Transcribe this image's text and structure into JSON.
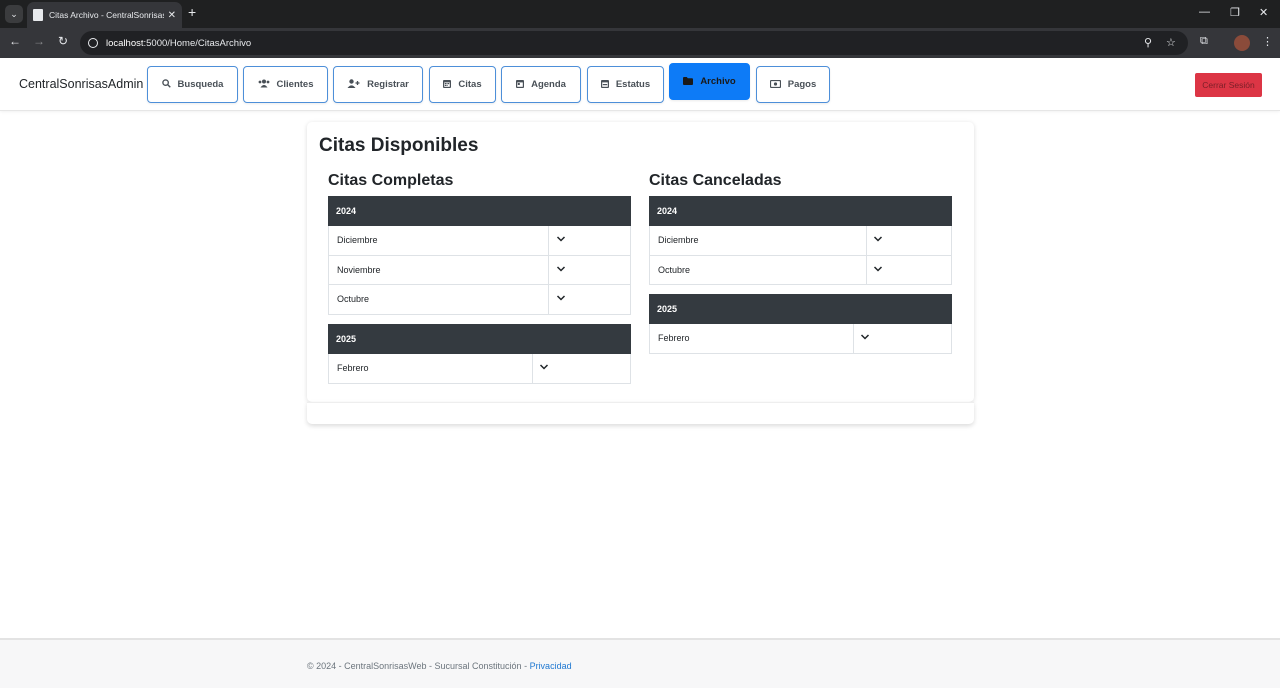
{
  "browser": {
    "tab_title": "Citas Archivo - CentralSonrisasWeb",
    "tab_close": "✕",
    "new_tab": "+",
    "url_host": "localhost",
    "url_rest": ":5000/Home/CitasArchivo"
  },
  "navbar": {
    "brand": "CentralSonrisasAdmin",
    "items": [
      {
        "label": "Busqueda",
        "icon": "search-icon"
      },
      {
        "label": "Clientes",
        "icon": "users-icon"
      },
      {
        "label": "Registrar",
        "icon": "user-plus-icon"
      },
      {
        "label": "Citas",
        "icon": "calendar-icon"
      },
      {
        "label": "Agenda",
        "icon": "calendar-day-icon"
      },
      {
        "label": "Estatus",
        "icon": "calendar-check-icon"
      },
      {
        "label": "Archivo",
        "icon": "folder-icon",
        "active": true
      },
      {
        "label": "Pagos",
        "icon": "money-icon"
      }
    ],
    "logout_label": "Cerrar Sesión"
  },
  "main": {
    "title": "Citas Disponibles",
    "completed": {
      "title": "Citas Completas",
      "years": [
        {
          "year": "2024",
          "months": [
            "Diciembre",
            "Noviembre",
            "Octubre"
          ]
        },
        {
          "year": "2025",
          "months": [
            "Febrero"
          ]
        }
      ]
    },
    "cancelled": {
      "title": "Citas Canceladas",
      "years": [
        {
          "year": "2024",
          "months": [
            "Diciembre",
            "Octubre"
          ]
        },
        {
          "year": "2025",
          "months": [
            "Febrero"
          ]
        }
      ]
    }
  },
  "footer": {
    "text": "© 2024 - CentralSonrisasWeb - Sucursal Constitución - ",
    "link": "Privacidad"
  },
  "colors": {
    "primary": "#0d7bf7",
    "danger": "#dc3545",
    "table_header": "#343a40"
  }
}
